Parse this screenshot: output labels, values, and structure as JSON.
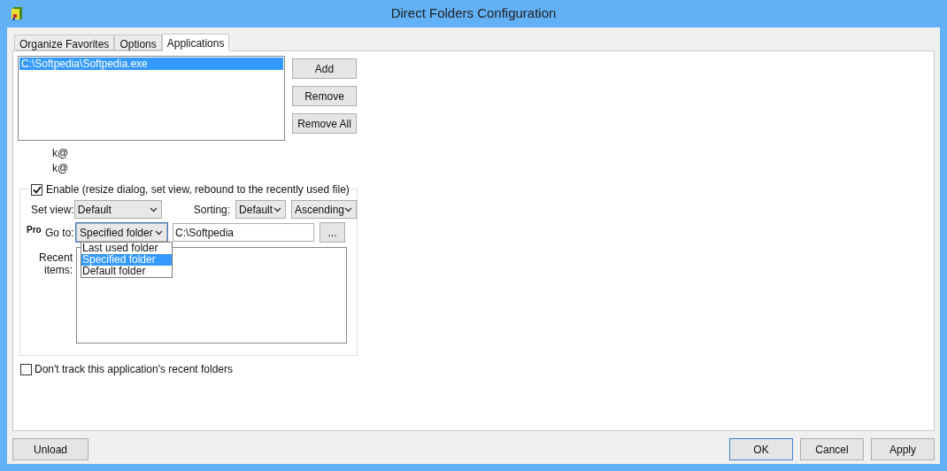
{
  "window": {
    "title": "Direct Folders Configuration"
  },
  "tabs": [
    {
      "label": "Organize Favorites",
      "selected": false
    },
    {
      "label": "Options",
      "selected": false
    },
    {
      "label": "Applications",
      "selected": true
    }
  ],
  "applications": [
    {
      "path": "C:\\Softpedia\\Softpedia.exe",
      "selected": true
    }
  ],
  "list_buttons": [
    "Add",
    "Remove",
    "Remove All"
  ],
  "hotkeys": [
    "k@",
    "k@"
  ],
  "enable": {
    "label": "Enable (resize dialog, set view, rebound to the recently used file)",
    "checked": true
  },
  "set_view": {
    "label": "Set view:",
    "value": "Default"
  },
  "sorting": {
    "label": "Sorting:",
    "value": "Default",
    "order": "Ascending"
  },
  "go_to": {
    "badge": "Pro",
    "label": "Go to:",
    "value": "Specified folder",
    "expanded": true,
    "options": [
      {
        "label": "Last used folder",
        "selected": false
      },
      {
        "label": "Specified folder",
        "selected": true
      },
      {
        "label": "Default folder",
        "selected": false
      }
    ],
    "path": "C:\\Softpedia",
    "browse": "..."
  },
  "recent_items": {
    "label": "Recent items:"
  },
  "dont_track": {
    "label": "Don't track this application's recent folders",
    "checked": false
  },
  "bottom_left": {
    "label": "Unload",
    "focused": false
  },
  "bottom_buttons": [
    {
      "label": "OK",
      "focused": true
    },
    {
      "label": "Cancel",
      "focused": false
    },
    {
      "label": "Apply",
      "focused": false
    }
  ]
}
